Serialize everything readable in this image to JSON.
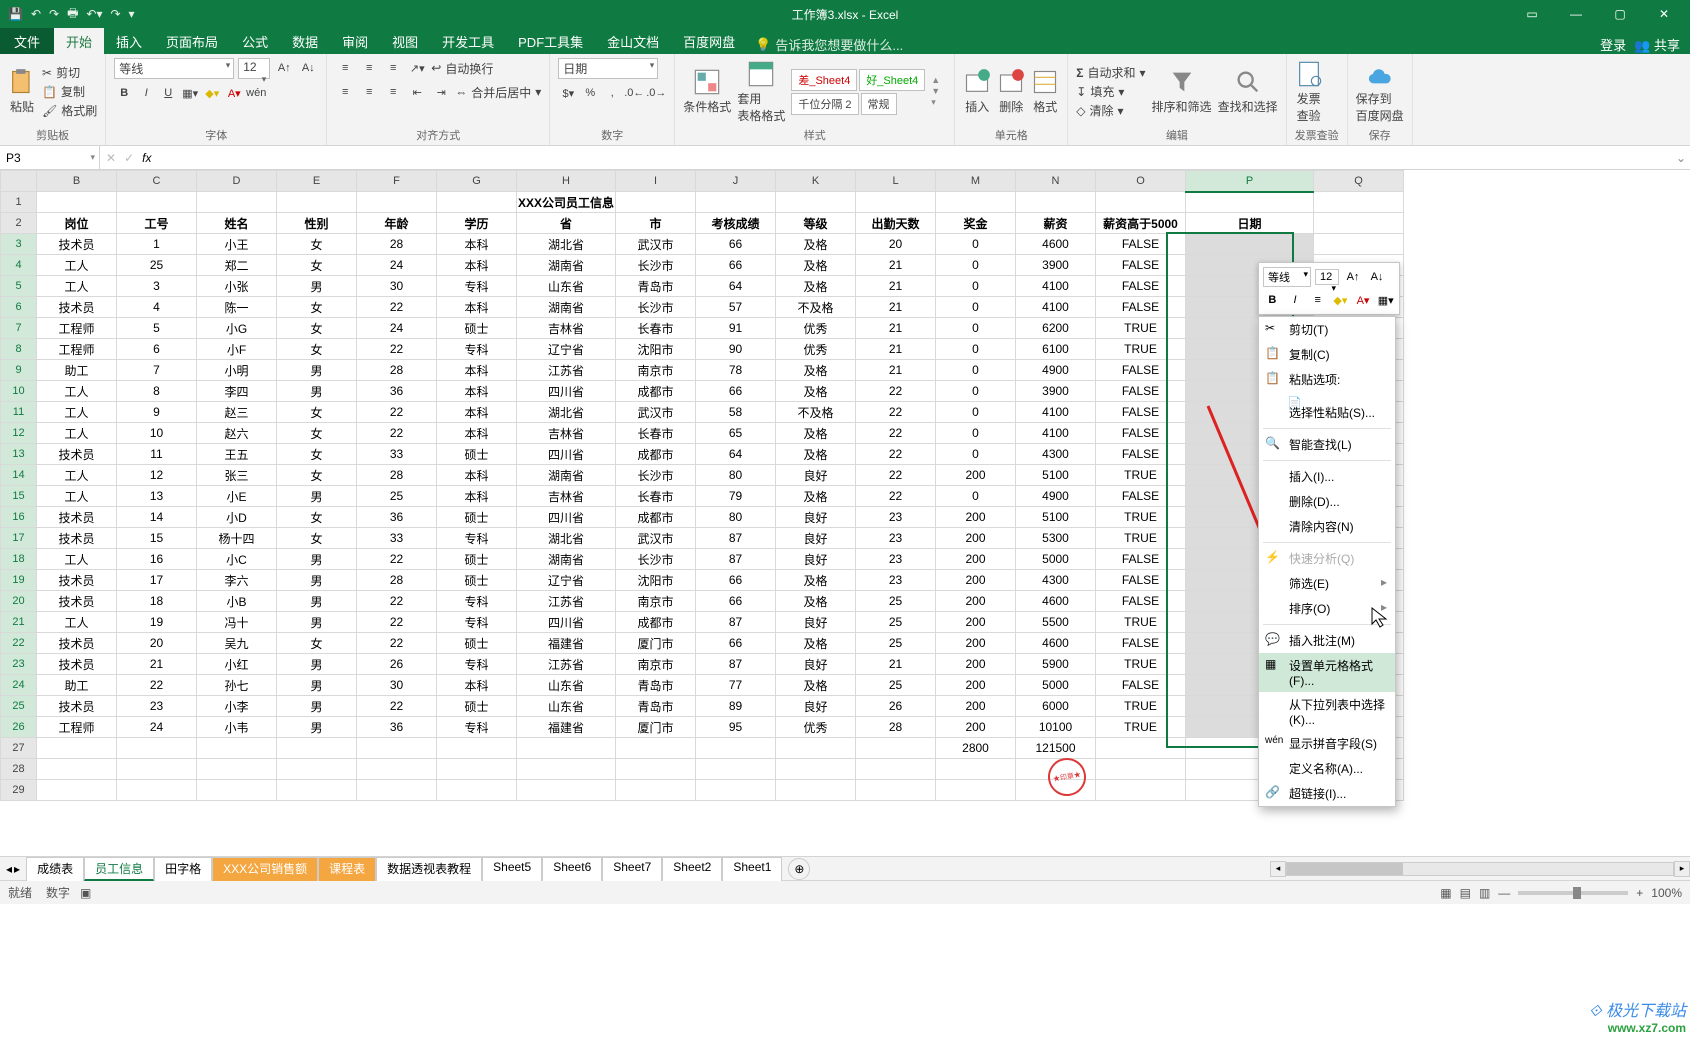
{
  "title": "工作簿3.xlsx - Excel",
  "login": "登录",
  "share": "共享",
  "file_tab": "文件",
  "tabs": [
    "开始",
    "插入",
    "页面布局",
    "公式",
    "数据",
    "审阅",
    "视图",
    "开发工具",
    "PDF工具集",
    "金山文档",
    "百度网盘"
  ],
  "tellme": "告诉我您想要做什么...",
  "namebox": "P3",
  "fx_label": "fx",
  "clipboard": {
    "label": "剪贴板",
    "paste": "粘贴",
    "cut": "剪切",
    "copy": "复制",
    "painter": "格式刷"
  },
  "font": {
    "label": "字体",
    "name": "等线",
    "size": "12",
    "wen": "wén"
  },
  "alignment": {
    "label": "对齐方式",
    "wrap": "自动换行",
    "merge": "合并后居中"
  },
  "number": {
    "label": "数字",
    "cat": "日期"
  },
  "styles": {
    "label": "样式",
    "cond": "条件格式",
    "tbl": "套用\n表格格式",
    "thousands": "千位分隔 2",
    "normal": "常规",
    "bad": "差_Sheet4",
    "good": "好_Sheet4"
  },
  "cells": {
    "label": "单元格",
    "insert": "插入",
    "delete": "删除",
    "format": "格式"
  },
  "editing": {
    "label": "编辑",
    "autosum": "自动求和",
    "fill": "填充",
    "clear": "清除",
    "sort": "排序和筛选",
    "find": "查找和选择"
  },
  "invoice": {
    "label": "发票查验",
    "btn": "发票\n查验"
  },
  "saveto": {
    "label": "保存",
    "btn": "保存到\n百度网盘"
  },
  "columns": [
    "B",
    "C",
    "D",
    "E",
    "F",
    "G",
    "H",
    "I",
    "J",
    "K",
    "L",
    "M",
    "N",
    "O",
    "P",
    "Q"
  ],
  "chart_data": {
    "title": "XXX公司员工信息",
    "headers": [
      "岗位",
      "工号",
      "姓名",
      "性别",
      "年龄",
      "学历",
      "省",
      "市",
      "考核成绩",
      "等级",
      "出勤天数",
      "奖金",
      "薪资",
      "薪资高于5000",
      "日期"
    ],
    "rows": [
      [
        "技术员",
        "1",
        "小王",
        "女",
        "28",
        "本科",
        "湖北省",
        "武汉市",
        "66",
        "及格",
        "20",
        "0",
        "4600",
        "FALSE",
        ""
      ],
      [
        "工人",
        "25",
        "郑二",
        "女",
        "24",
        "本科",
        "湖南省",
        "长沙市",
        "66",
        "及格",
        "21",
        "0",
        "3900",
        "FALSE",
        ""
      ],
      [
        "工人",
        "3",
        "小张",
        "男",
        "30",
        "专科",
        "山东省",
        "青岛市",
        "64",
        "及格",
        "21",
        "0",
        "4100",
        "FALSE",
        ""
      ],
      [
        "技术员",
        "4",
        "陈一",
        "女",
        "22",
        "本科",
        "湖南省",
        "长沙市",
        "57",
        "不及格",
        "21",
        "0",
        "4100",
        "FALSE",
        ""
      ],
      [
        "工程师",
        "5",
        "小G",
        "女",
        "24",
        "硕士",
        "吉林省",
        "长春市",
        "91",
        "优秀",
        "21",
        "0",
        "6200",
        "TRUE",
        ""
      ],
      [
        "工程师",
        "6",
        "小F",
        "女",
        "22",
        "专科",
        "辽宁省",
        "沈阳市",
        "90",
        "优秀",
        "21",
        "0",
        "6100",
        "TRUE",
        ""
      ],
      [
        "助工",
        "7",
        "小明",
        "男",
        "28",
        "本科",
        "江苏省",
        "南京市",
        "78",
        "及格",
        "21",
        "0",
        "4900",
        "FALSE",
        ""
      ],
      [
        "工人",
        "8",
        "李四",
        "男",
        "36",
        "本科",
        "四川省",
        "成都市",
        "66",
        "及格",
        "22",
        "0",
        "3900",
        "FALSE",
        ""
      ],
      [
        "工人",
        "9",
        "赵三",
        "女",
        "22",
        "本科",
        "湖北省",
        "武汉市",
        "58",
        "不及格",
        "22",
        "0",
        "4100",
        "FALSE",
        ""
      ],
      [
        "工人",
        "10",
        "赵六",
        "女",
        "22",
        "本科",
        "吉林省",
        "长春市",
        "65",
        "及格",
        "22",
        "0",
        "4100",
        "FALSE",
        ""
      ],
      [
        "技术员",
        "11",
        "王五",
        "女",
        "33",
        "硕士",
        "四川省",
        "成都市",
        "64",
        "及格",
        "22",
        "0",
        "4300",
        "FALSE",
        ""
      ],
      [
        "工人",
        "12",
        "张三",
        "女",
        "28",
        "本科",
        "湖南省",
        "长沙市",
        "80",
        "良好",
        "22",
        "200",
        "5100",
        "TRUE",
        ""
      ],
      [
        "工人",
        "13",
        "小E",
        "男",
        "25",
        "本科",
        "吉林省",
        "长春市",
        "79",
        "及格",
        "22",
        "0",
        "4900",
        "FALSE",
        ""
      ],
      [
        "技术员",
        "14",
        "小D",
        "女",
        "36",
        "硕士",
        "四川省",
        "成都市",
        "80",
        "良好",
        "23",
        "200",
        "5100",
        "TRUE",
        ""
      ],
      [
        "技术员",
        "15",
        "杨十四",
        "女",
        "33",
        "专科",
        "湖北省",
        "武汉市",
        "87",
        "良好",
        "23",
        "200",
        "5300",
        "TRUE",
        ""
      ],
      [
        "工人",
        "16",
        "小C",
        "男",
        "22",
        "硕士",
        "湖南省",
        "长沙市",
        "87",
        "良好",
        "23",
        "200",
        "5000",
        "FALSE",
        ""
      ],
      [
        "技术员",
        "17",
        "李六",
        "男",
        "28",
        "硕士",
        "辽宁省",
        "沈阳市",
        "66",
        "及格",
        "23",
        "200",
        "4300",
        "FALSE",
        ""
      ],
      [
        "技术员",
        "18",
        "小B",
        "男",
        "22",
        "专科",
        "江苏省",
        "南京市",
        "66",
        "及格",
        "25",
        "200",
        "4600",
        "FALSE",
        ""
      ],
      [
        "工人",
        "19",
        "冯十",
        "男",
        "22",
        "专科",
        "四川省",
        "成都市",
        "87",
        "良好",
        "25",
        "200",
        "5500",
        "TRUE",
        ""
      ],
      [
        "技术员",
        "20",
        "吴九",
        "女",
        "22",
        "硕士",
        "福建省",
        "厦门市",
        "66",
        "及格",
        "25",
        "200",
        "4600",
        "FALSE",
        ""
      ],
      [
        "技术员",
        "21",
        "小红",
        "男",
        "26",
        "专科",
        "江苏省",
        "南京市",
        "87",
        "良好",
        "21",
        "200",
        "5900",
        "TRUE",
        ""
      ],
      [
        "助工",
        "22",
        "孙七",
        "男",
        "30",
        "本科",
        "山东省",
        "青岛市",
        "77",
        "及格",
        "25",
        "200",
        "5000",
        "FALSE",
        ""
      ],
      [
        "技术员",
        "23",
        "小李",
        "男",
        "22",
        "硕士",
        "山东省",
        "青岛市",
        "89",
        "良好",
        "26",
        "200",
        "6000",
        "TRUE",
        ""
      ],
      [
        "工程师",
        "24",
        "小韦",
        "男",
        "36",
        "专科",
        "福建省",
        "厦门市",
        "95",
        "优秀",
        "28",
        "200",
        "10100",
        "TRUE",
        ""
      ],
      [
        "",
        "",
        "",
        "",
        "",
        "",
        "",
        "",
        "",
        "",
        "",
        "2800",
        "121500",
        "",
        ""
      ]
    ]
  },
  "mini": {
    "font": "等线",
    "size": "12"
  },
  "ctx": {
    "cut": "剪切(T)",
    "copy": "复制(C)",
    "paste_opts": "粘贴选项:",
    "paste_special": "选择性粘贴(S)...",
    "smart": "智能查找(L)",
    "insert": "插入(I)...",
    "delete": "删除(D)...",
    "clear": "清除内容(N)",
    "quick": "快速分析(Q)",
    "filter": "筛选(E)",
    "sort": "排序(O)",
    "comment": "插入批注(M)",
    "format": "设置单元格格式(F)...",
    "dropdown": "从下拉列表中选择(K)...",
    "pinyin": "显示拼音字段(S)",
    "name": "定义名称(A)...",
    "link": "超链接(I)..."
  },
  "sheets": [
    "成绩表",
    "员工信息",
    "田字格",
    "XXX公司销售额",
    "课程表",
    "数据透视表教程",
    "Sheet5",
    "Sheet6",
    "Sheet7",
    "Sheet2",
    "Sheet1"
  ],
  "status": {
    "ready": "就绪",
    "count_lbl": "数字",
    "zoom": "100%"
  },
  "watermark": {
    "l1": "极光下载站",
    "l2": "www.xz7.com"
  }
}
